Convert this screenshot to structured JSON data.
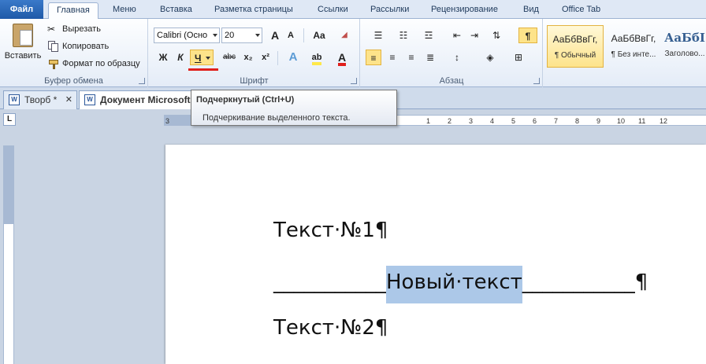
{
  "ribbon_tabs": {
    "file": "Файл",
    "home": "Главная",
    "menu": "Меню",
    "insert": "Вставка",
    "layout": "Разметка страницы",
    "links": "Ссылки",
    "mailings": "Рассылки",
    "review": "Рецензирование",
    "view": "Вид",
    "office_tab": "Office Tab"
  },
  "clipboard": {
    "paste": "Вставить",
    "cut": "Вырезать",
    "copy": "Копировать",
    "format_painter": "Формат по образцу",
    "label": "Буфер обмена"
  },
  "font": {
    "name": "Calibri (Осно",
    "size": "20",
    "bold": "Ж",
    "italic": "К",
    "underline": "Ч",
    "strike": "abc",
    "subscript": "x₂",
    "superscript": "x²",
    "grow": "A",
    "shrink": "A",
    "case": "Aa",
    "label": "Шрифт"
  },
  "paragraph": {
    "label": "Абзац",
    "pilcrow": "¶"
  },
  "styles": {
    "items": [
      {
        "sample": "АаБбВвГг,",
        "name": "¶ Обычный"
      },
      {
        "sample": "АаБбВвГг,",
        "name": "¶ Без инте..."
      },
      {
        "sample": "АаБбI",
        "name": "Заголово..."
      }
    ]
  },
  "doc_tabs": [
    {
      "title": "Творб *",
      "close": "✕"
    },
    {
      "title": "Документ Microsoft"
    }
  ],
  "tooltip": {
    "title": "Подчеркнутый (Ctrl+U)",
    "description": "Подчеркивание выделенного текста."
  },
  "ruler": {
    "corner": "L",
    "ticks": [
      "3",
      "1",
      "2",
      "3",
      "4",
      "5",
      "6",
      "7",
      "8",
      "9",
      "10",
      "11",
      "12"
    ]
  },
  "document": {
    "line1": "Текст·№1¶",
    "line2_before": "___________",
    "line2_selected": "Новый·текст",
    "line2_after": "___________¶",
    "line3": "Текст·№2¶"
  },
  "colors": {
    "file_tab": "#2a65b5",
    "selection": "#acc8e8",
    "underline_accent": "#e0201c",
    "highlight_yellow": "#ffe84a",
    "font_red": "#e0201c"
  }
}
